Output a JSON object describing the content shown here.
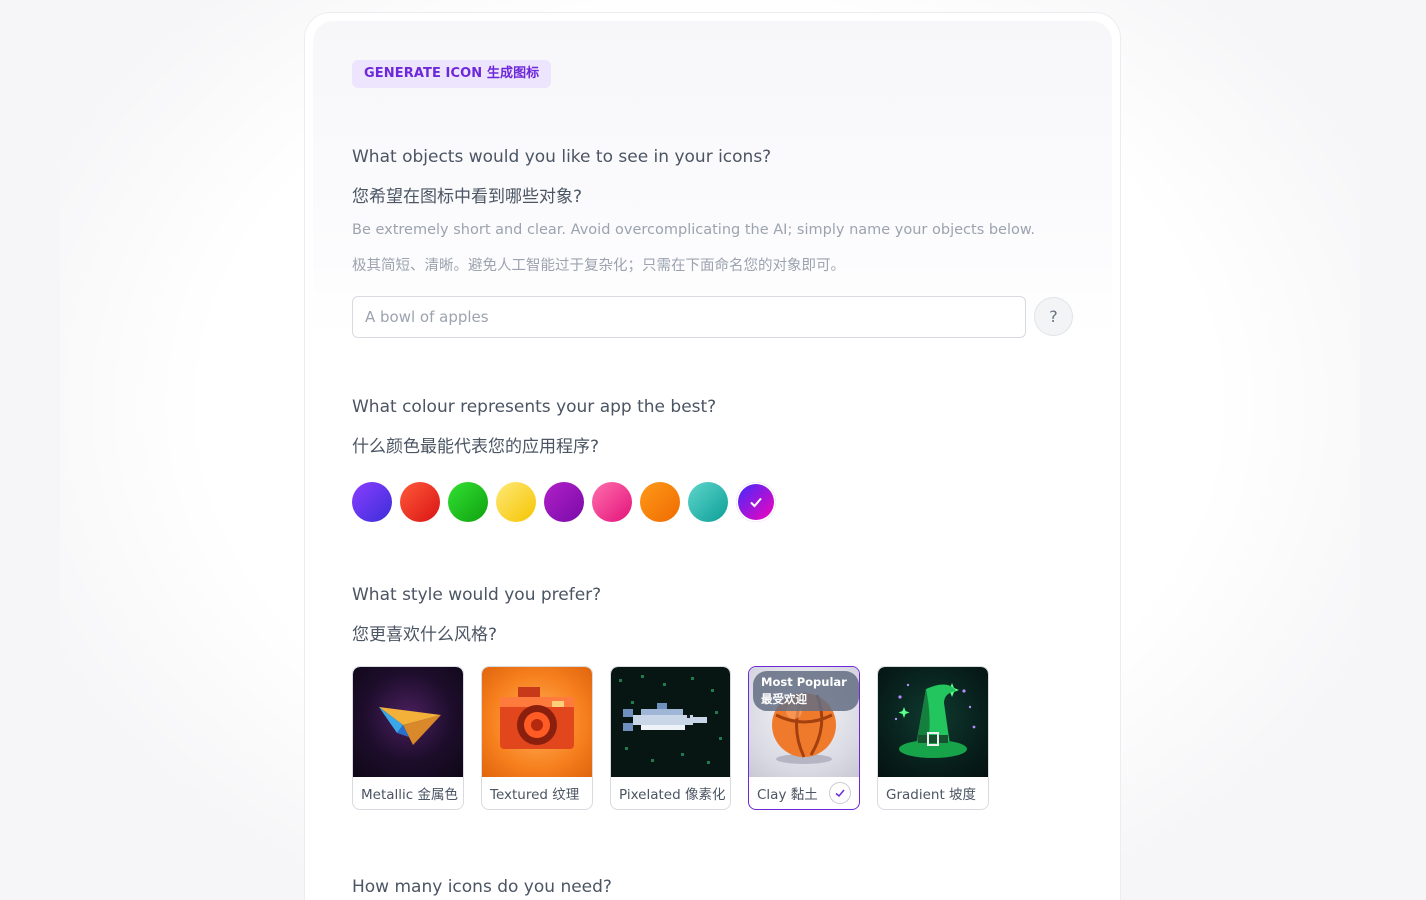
{
  "badge": "GENERATE ICON 生成图标",
  "objects": {
    "question_en": "What objects would you like to see in your icons?",
    "question_zh": "您希望在图标中看到哪些对象?",
    "hint_en": "Be extremely short and clear. Avoid overcomplicating the AI; simply name your objects below.",
    "hint_zh": "极其简短、清晰。避免人工智能过于复杂化；只需在下面命名您的对象即可。",
    "input_value": "",
    "input_placeholder": "A bowl of apples",
    "help_label": "?"
  },
  "colour": {
    "question_en": "What colour represents your app the best?",
    "question_zh": "什么颜色最能代表您的应用程序?",
    "swatches": [
      {
        "name": "blue-purple",
        "from": "#3b2fd9",
        "to": "#8b3dff",
        "selected": false
      },
      {
        "name": "red",
        "from": "#d91414",
        "to": "#ff5a3a",
        "selected": false
      },
      {
        "name": "green",
        "from": "#0fa10f",
        "to": "#33e033",
        "selected": false
      },
      {
        "name": "yellow",
        "from": "#f5c400",
        "to": "#ffe978",
        "selected": false
      },
      {
        "name": "purple",
        "from": "#7a0aa8",
        "to": "#b021c9",
        "selected": false
      },
      {
        "name": "pink",
        "from": "#e3127a",
        "to": "#ff6fae",
        "selected": false
      },
      {
        "name": "orange",
        "from": "#ef6a00",
        "to": "#ff9a1a",
        "selected": false
      },
      {
        "name": "teal",
        "from": "#0c9e96",
        "to": "#5fd6cc",
        "selected": false
      },
      {
        "name": "magenta-blue",
        "from": "#ff00b8",
        "to": "#3a2cff",
        "selected": true
      }
    ]
  },
  "style": {
    "question_en": "What style would you prefer?",
    "question_zh": "您更喜欢什么风格?",
    "options": [
      {
        "label": "Metallic 金属色",
        "icon": "paper-plane-icon",
        "selected": false
      },
      {
        "label": "Textured 纹理",
        "icon": "camera-icon",
        "selected": false
      },
      {
        "label": "Pixelated 像素化",
        "icon": "dolphin-icon",
        "selected": false
      },
      {
        "label": "Clay 黏土",
        "icon": "basketball-icon",
        "selected": true,
        "badge": "Most Popular 最受欢迎"
      },
      {
        "label": "Gradient 坡度",
        "icon": "witch-hat-icon",
        "selected": false
      }
    ]
  },
  "count": {
    "question_en": "How many icons do you need?"
  }
}
